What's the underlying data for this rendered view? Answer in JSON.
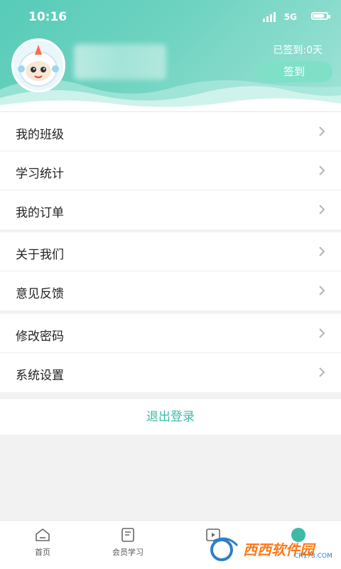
{
  "status_bar": {
    "time": "10:16",
    "network": "5G"
  },
  "profile": {
    "checkin_text": "已签到:0天",
    "checkin_button": "签到"
  },
  "menu_group1": [
    {
      "label": "我的班级"
    },
    {
      "label": "学习统计"
    },
    {
      "label": "我的订单"
    }
  ],
  "menu_group2": [
    {
      "label": "关于我们"
    },
    {
      "label": "意见反馈"
    }
  ],
  "menu_group3": [
    {
      "label": "修改密码"
    },
    {
      "label": "系统设置"
    }
  ],
  "logout_label": "退出登录",
  "tabs": [
    {
      "label": "首页",
      "icon": "home-icon"
    },
    {
      "label": "会员学习",
      "icon": "book-icon"
    },
    {
      "label": "",
      "icon": "video-icon"
    },
    {
      "label": "",
      "icon": "profile-icon"
    }
  ],
  "watermark": {
    "text": "西西软件园",
    "sub": "CR173.COM"
  },
  "colors": {
    "accent": "#3ebaa7",
    "header": "#57cbb8"
  }
}
